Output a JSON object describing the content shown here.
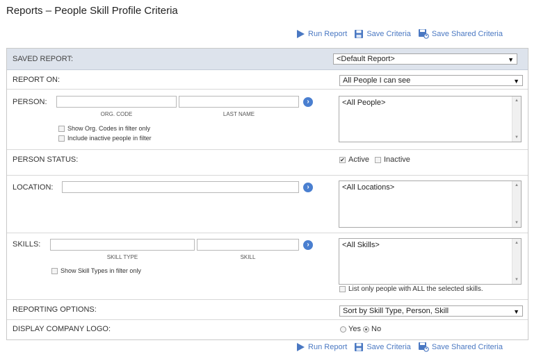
{
  "title": "Reports – People Skill Profile Criteria",
  "toolbar": {
    "run": "Run Report",
    "save": "Save Criteria",
    "save_shared": "Save Shared Criteria"
  },
  "saved_report": {
    "label": "SAVED REPORT:",
    "value": "<Default Report>"
  },
  "report_on": {
    "label": "REPORT ON:",
    "value": "All People I can see"
  },
  "person": {
    "label": "PERSON:",
    "org_code_caption": "ORG. CODE",
    "last_name_caption": "LAST NAME",
    "org_code_value": "",
    "last_name_value": "",
    "show_org_codes": "Show Org. Codes in filter only",
    "include_inactive": "Include inactive people in filter",
    "list_item": "<All People>"
  },
  "person_status": {
    "label": "PERSON STATUS:",
    "active": "Active",
    "active_checked": true,
    "inactive": "Inactive",
    "inactive_checked": false
  },
  "location": {
    "label": "LOCATION:",
    "value": "",
    "list_item": "<All Locations>"
  },
  "skills": {
    "label": "SKILLS:",
    "skill_type_caption": "SKILL TYPE",
    "skill_caption": "SKILL",
    "skill_type_value": "",
    "skill_value": "",
    "show_skill_types": "Show Skill Types in filter only",
    "list_item": "<All Skills>",
    "list_all_selected": "List only people with ALL the selected skills."
  },
  "reporting_options": {
    "label": "REPORTING OPTIONS:",
    "value": "Sort by Skill Type, Person, Skill"
  },
  "company_logo": {
    "label": "DISPLAY COMPANY LOGO:",
    "yes": "Yes",
    "no": "No",
    "selected": "No"
  },
  "colors": {
    "accent": "#4a78c2",
    "header_band": "#dde3ec"
  },
  "icons": {
    "run": "play-icon",
    "save": "floppy-disk-icon",
    "save_shared": "shared-floppy-icon",
    "go": "chevron-right-circle-icon"
  }
}
